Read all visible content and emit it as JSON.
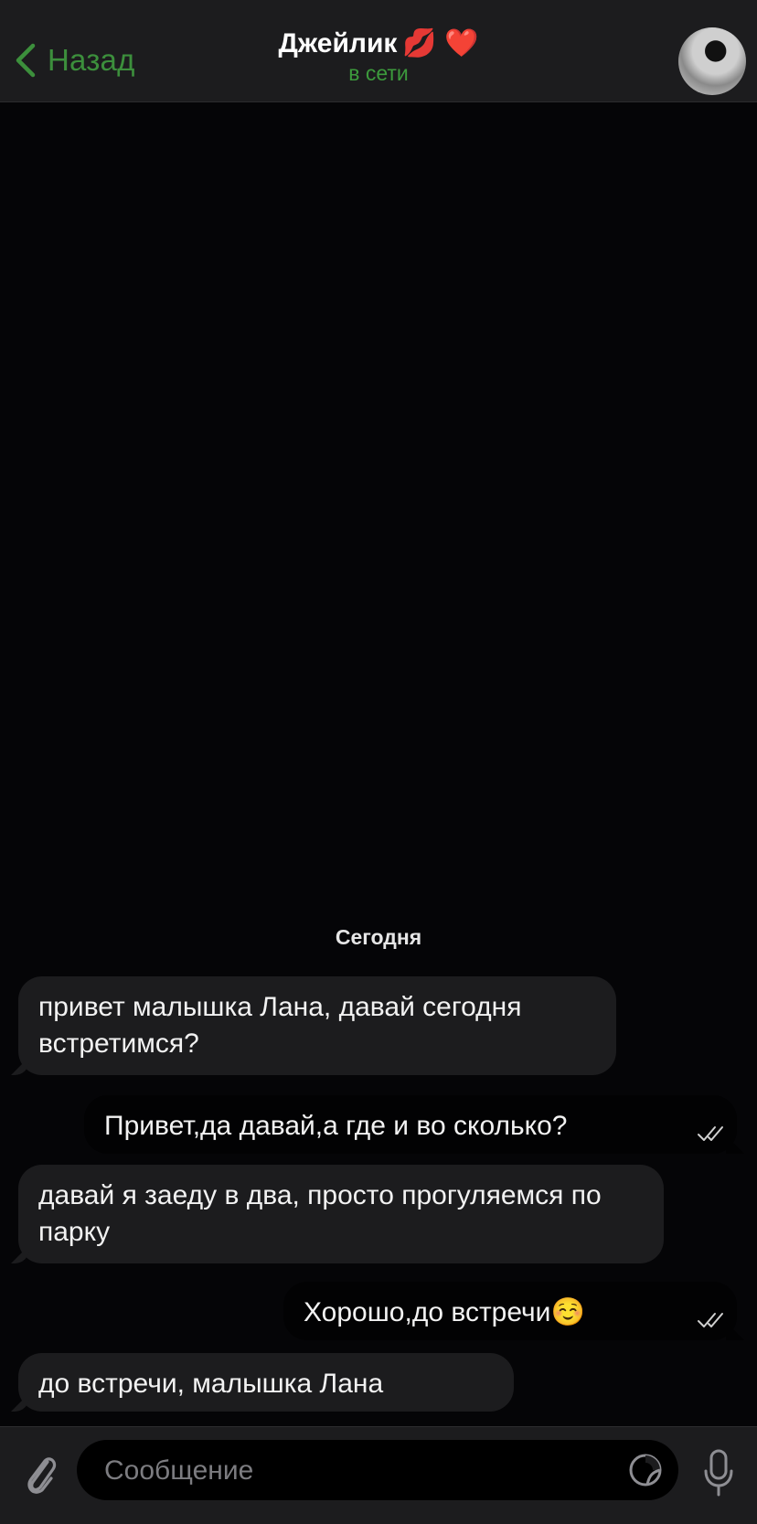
{
  "header": {
    "back_label": "Назад",
    "contact_name": "Джейлик",
    "contact_emojis": "💋 ❤️",
    "status": "в сети"
  },
  "chat": {
    "date_separator": "Сегодня",
    "messages": [
      {
        "direction": "incoming",
        "text": "привет малышка Лана, давай сегодня встретимся?"
      },
      {
        "direction": "outgoing",
        "text": "Привет,да давай,а где и во сколько?",
        "read": true
      },
      {
        "direction": "incoming",
        "text": "давай я заеду в два, просто прогуляемся по парку"
      },
      {
        "direction": "outgoing",
        "text": "Хорошо,до встречи☺️",
        "read": true
      },
      {
        "direction": "incoming",
        "text": "до встречи, малышка Лана"
      }
    ]
  },
  "composer": {
    "placeholder": "Сообщение"
  },
  "colors": {
    "accent": "#3c8f3c",
    "header_bg": "#1c1c1e",
    "incoming_bubble": "#1c1c1e",
    "outgoing_bubble": "#020203",
    "chat_bg": "#050507"
  },
  "icons": [
    "chevron-left-icon",
    "paperclip-icon",
    "sticker-icon",
    "microphone-icon",
    "double-check-icon"
  ]
}
